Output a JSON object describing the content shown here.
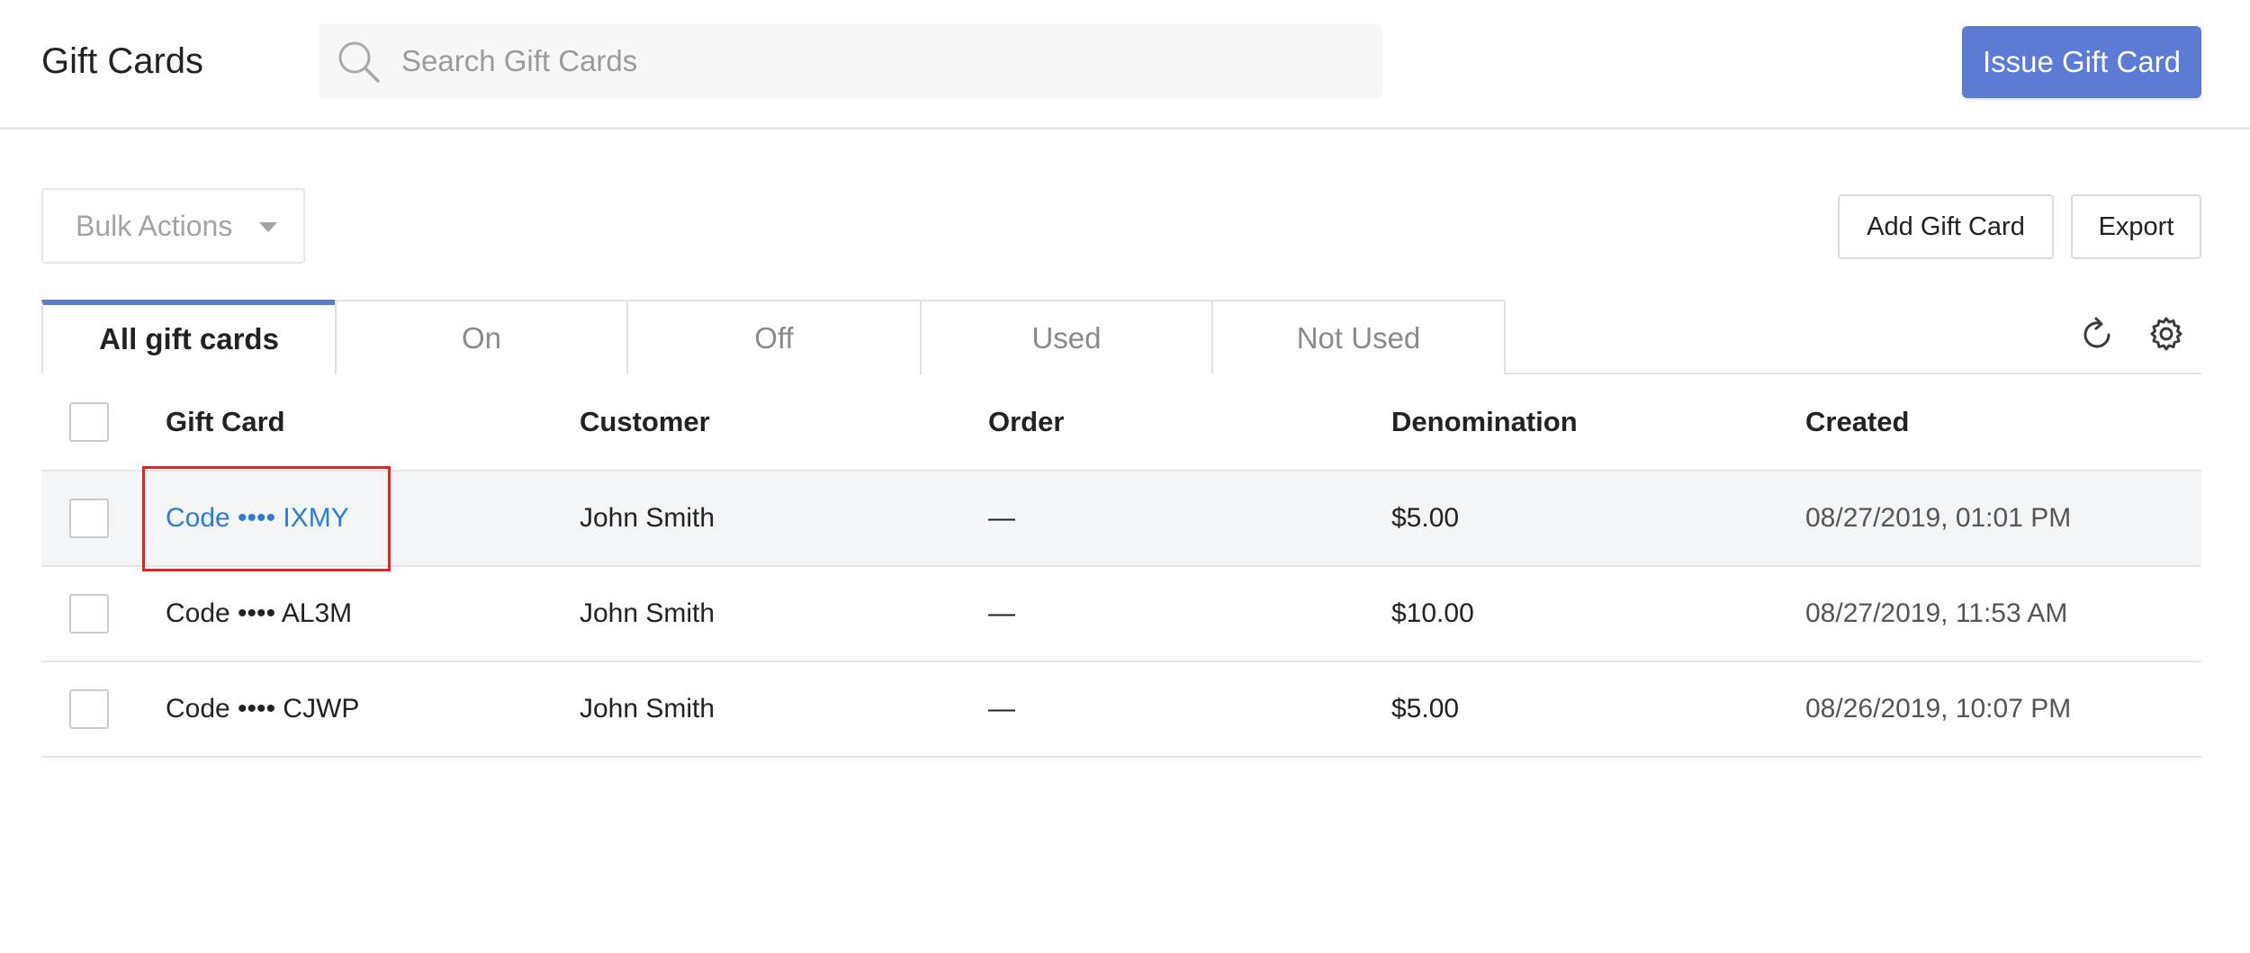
{
  "header": {
    "title": "Gift Cards",
    "search_placeholder": "Search Gift Cards",
    "search_value": "",
    "issue_button": "Issue Gift Card",
    "accent_color": "#5b7bd5"
  },
  "toolbar": {
    "bulk_actions": "Bulk Actions",
    "add_gift_card": "Add Gift Card",
    "export": "Export"
  },
  "tabs": [
    {
      "label": "All gift cards",
      "active": true
    },
    {
      "label": "On",
      "active": false
    },
    {
      "label": "Off",
      "active": false
    },
    {
      "label": "Used",
      "active": false
    },
    {
      "label": "Not Used",
      "active": false
    }
  ],
  "icons": {
    "refresh": "refresh-icon",
    "settings": "gear-icon",
    "search": "search-icon"
  },
  "table": {
    "columns": [
      "Gift Card",
      "Customer",
      "Order",
      "Denomination",
      "Created"
    ],
    "rows": [
      {
        "gift_card": "Code •••• IXMY",
        "customer": "John Smith",
        "order": "—",
        "denomination": "$5.00",
        "created": "08/27/2019, 01:01 PM",
        "highlighted": true
      },
      {
        "gift_card": "Code •••• AL3M",
        "customer": "John Smith",
        "order": "—",
        "denomination": "$10.00",
        "created": "08/27/2019, 11:53 AM",
        "highlighted": false
      },
      {
        "gift_card": "Code •••• CJWP",
        "customer": "John Smith",
        "order": "—",
        "denomination": "$5.00",
        "created": "08/26/2019, 10:07 PM",
        "highlighted": false
      }
    ]
  }
}
